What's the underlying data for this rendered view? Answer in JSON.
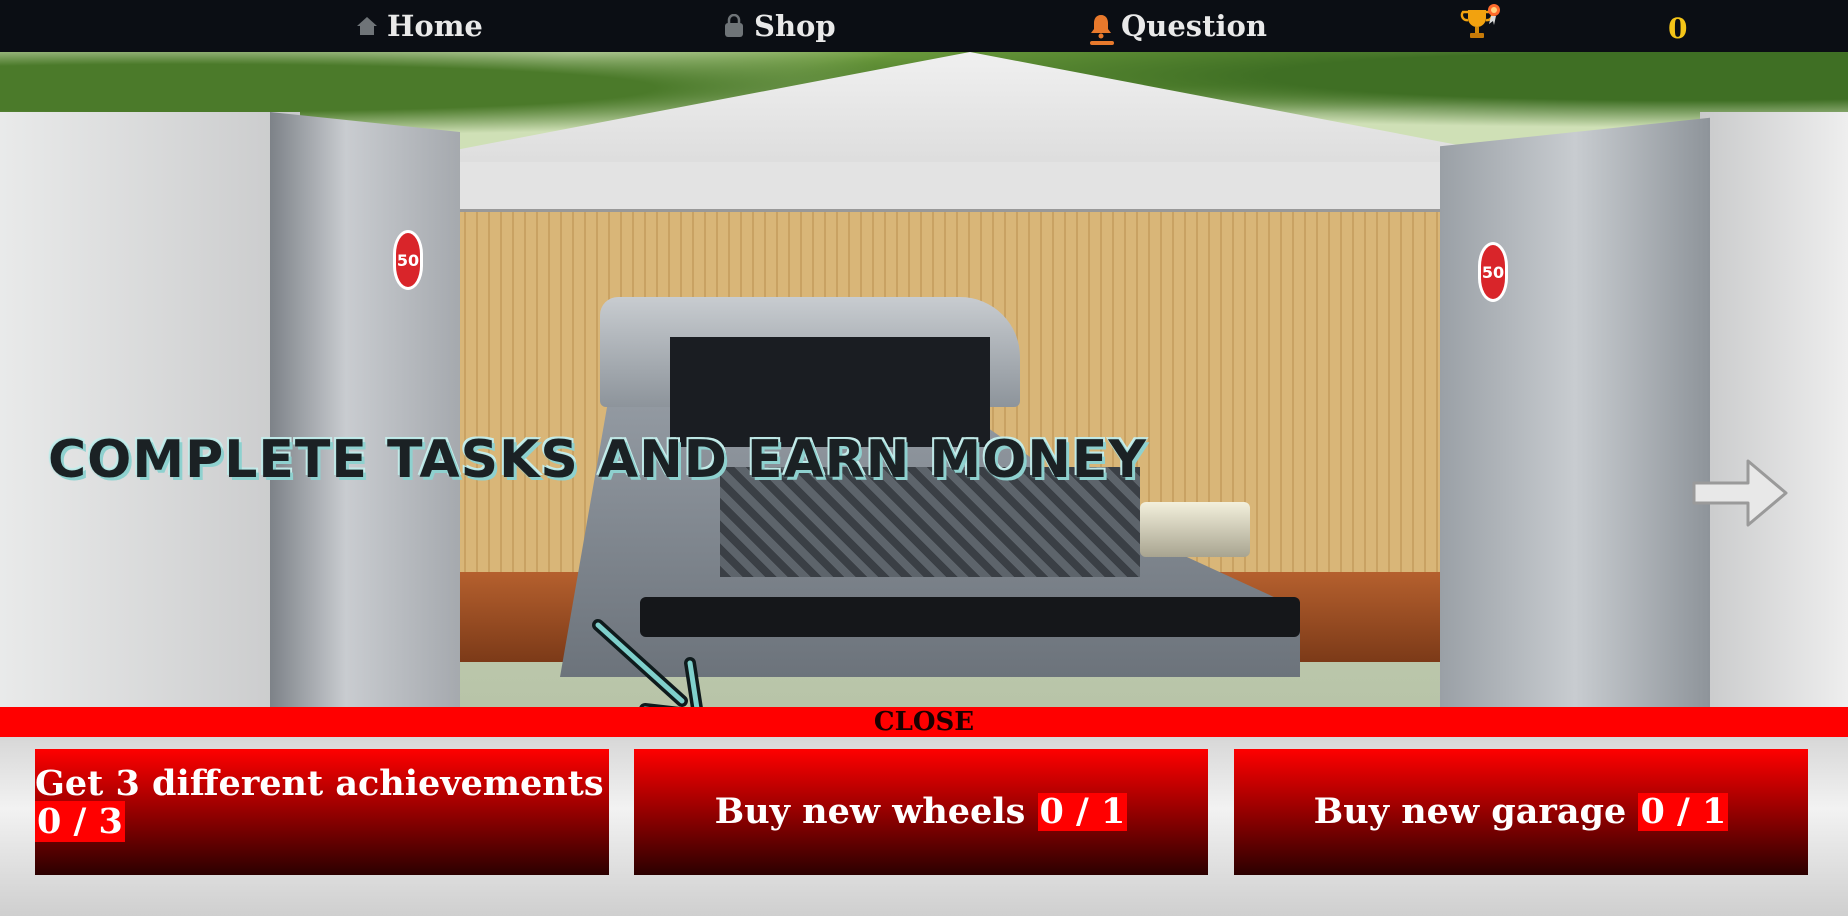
{
  "nav": {
    "home_label": "Home",
    "shop_label": "Shop",
    "question_label": "Question",
    "coins": "0"
  },
  "scene": {
    "title": "COMPLETE TASKS AND EARN MONEY",
    "badge_text": "50"
  },
  "close_label": "CLOSE",
  "tasks": [
    {
      "label": "Get 3 different achievements",
      "progress": "0 / 3"
    },
    {
      "label": "Buy new wheels",
      "progress": "0 / 1"
    },
    {
      "label": "Buy new garage",
      "progress": "0 / 1"
    }
  ],
  "colors": {
    "nav_bg": "#0b0e14",
    "coin": "#f5c518",
    "accent_red": "#ff0000",
    "underline": "#e8792c"
  },
  "icons": [
    "home-icon",
    "shopping-bag-icon",
    "bell-icon",
    "trophy-icon",
    "arrow-down-icon",
    "next-arrow-icon"
  ]
}
